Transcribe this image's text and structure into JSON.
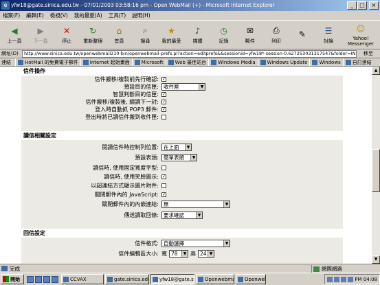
{
  "window": {
    "title": "yfw18@gate.sinica.edu.tw - 07/01/2003 03:58:16 pm - Open WebMail (+) - Microsoft Internet Explorer",
    "minimize": "_",
    "maximize": "□",
    "close": "×"
  },
  "menu": [
    "檔案(F)",
    "編輯(E)",
    "檢視(V)",
    "我的最愛(A)",
    "工具(T)",
    "說明(H)"
  ],
  "toolbar": [
    {
      "label": "上一頁",
      "icon": "back-icon"
    },
    {
      "label": "下一頁",
      "icon": "forward-icon"
    },
    {
      "label": "停止",
      "icon": "stop-icon"
    },
    {
      "label": "重新整理",
      "icon": "refresh-icon"
    },
    {
      "label": "首頁",
      "icon": "home-icon"
    },
    {
      "label": "搜尋",
      "icon": "search-icon"
    },
    {
      "label": "我的最愛",
      "icon": "favorites-icon"
    },
    {
      "label": "媒體",
      "icon": "media-icon"
    },
    {
      "label": "記錄",
      "icon": "history-icon"
    },
    {
      "label": "郵件",
      "icon": "mail-icon"
    },
    {
      "label": "列印",
      "icon": "print-icon"
    },
    {
      "label": "",
      "icon": "edit-icon"
    },
    {
      "label": "討論",
      "icon": "discuss-icon"
    },
    {
      "label": "Yahoo! Messenger",
      "icon": "yahoo-messenger-icon"
    }
  ],
  "address": {
    "label": "網址(D)",
    "url": "http://www.sinica.edu.tw/openwebmail210-bin/openwebmail-prefs.pl?action=editprefs&&sessionid=yfw18*-session-0.627253031317547&folder=IN",
    "go": "移至"
  },
  "links_bar": {
    "label": "連結",
    "items": [
      "HotMail 的免費電子郵件",
      "Internet 起始畫面",
      "Microsoft",
      "Web 最佳站台",
      "Windows Media",
      "Windows Update",
      "Windows",
      "自訂連結"
    ]
  },
  "sections": {
    "message_ops": {
      "title": "信件操作",
      "rows": [
        {
          "label": "信件搬移/複製前先行確認:",
          "checked": true
        },
        {
          "label": "預設目的信匣:",
          "select": "收件匣"
        },
        {
          "label": "智慧判斷目的信匣:",
          "checked": true
        },
        {
          "label": "信件搬移/複製後, 續讀下一封:",
          "checked": true
        },
        {
          "label": "登入時自動抓 POP3 郵件:",
          "checked": true
        },
        {
          "label": "登出時將已讀信件搬到收件匣:",
          "checked": false
        }
      ]
    },
    "read_settings": {
      "title": "讀信相關設定",
      "rows": [
        {
          "label": "閱讀信件時控制列位置:",
          "select": "在上面"
        },
        {
          "label": "預設表頭:",
          "select": "簡單表頭"
        },
        {
          "label": "讀信時, 使用固定寬度字型:",
          "checked": false
        },
        {
          "label": "讀信時, 使用笑臉圖示:",
          "checked": true
        },
        {
          "label": "以超連結方式顯示圖片附件:",
          "checked": false
        },
        {
          "label": "關閉郵件內的 JavaScript:",
          "checked": true
        },
        {
          "label": "關閉郵件內的內嵌連結:",
          "select": "無"
        },
        {
          "label": "傳送讀取回條:",
          "select": "要求確認"
        }
      ]
    },
    "reply_settings": {
      "title": "回信設定",
      "rows": [
        {
          "label": "信件格式:",
          "select": "自動選擇"
        },
        {
          "label": "信件編輯區大小:",
          "width_label": "寬",
          "width": "78",
          "height_label": "高",
          "height": "24"
        }
      ]
    }
  },
  "status": {
    "left": "完成",
    "right": "網際網路"
  },
  "taskbar": {
    "start": "開始",
    "tasks": [
      "CCVAX",
      "gate.sinica.edu....",
      "yfw18@gate.si...",
      "Openwebmail",
      "Openwebmail..."
    ],
    "clock": "PM 04:08"
  }
}
